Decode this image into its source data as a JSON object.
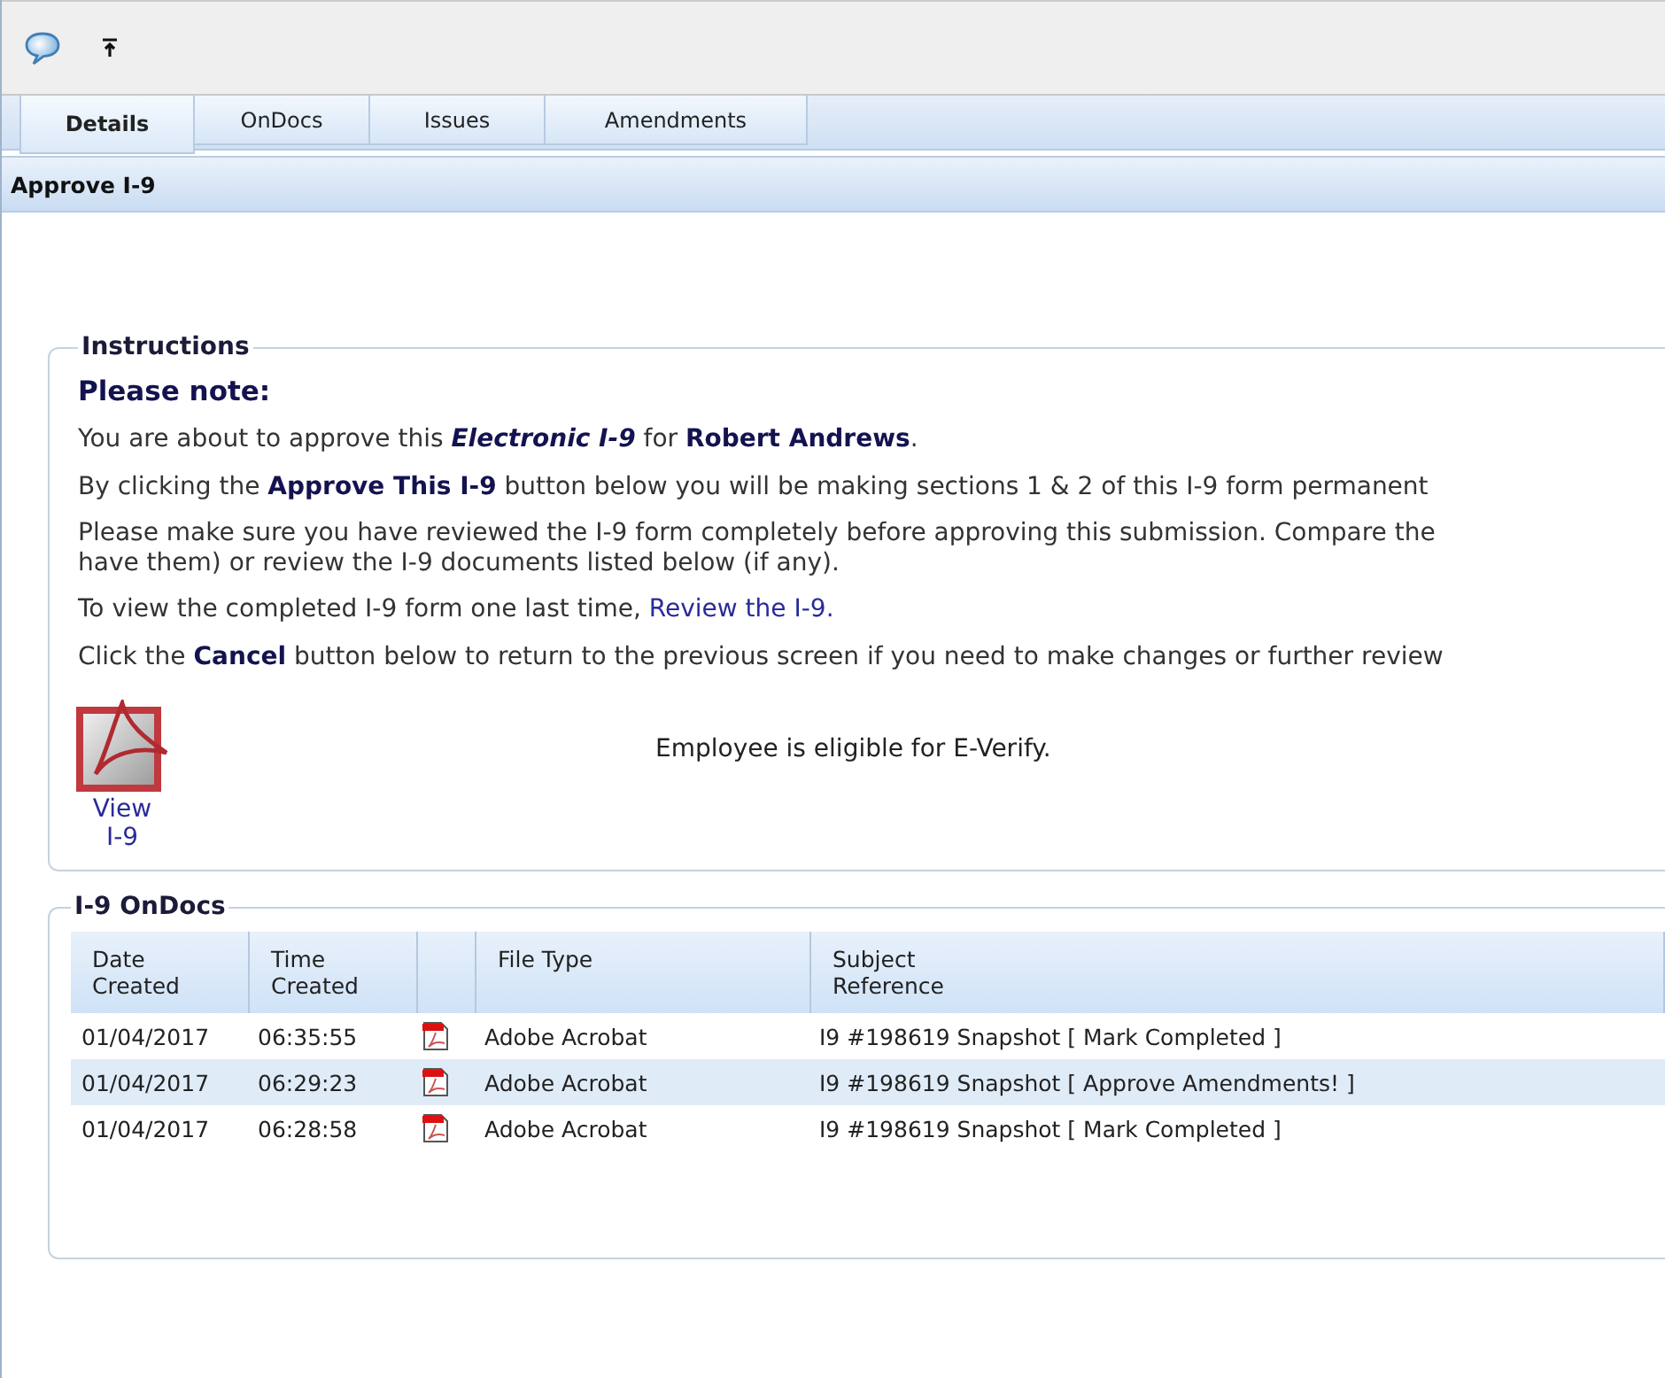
{
  "tabs": [
    {
      "label": "Details",
      "selected": true
    },
    {
      "label": "OnDocs",
      "selected": false
    },
    {
      "label": "Issues",
      "selected": false
    },
    {
      "label": "Amendments",
      "selected": false
    }
  ],
  "page_title": "Approve I-9",
  "instructions": {
    "legend": "Instructions",
    "heading": "Please note:",
    "paragraphs": [
      "You are about to approve this *Electronic I-9* for **Robert Andrews**.",
      "By clicking the **Approve This I-9** button below you will be making sections 1 & 2 of this I-9 form permanent",
      "Please make sure you have reviewed the I-9 form completely before approving this submission. Compare the\nhave them) or review the I-9 documents listed below (if any)."
    ],
    "review_text": "To view the completed I-9 form one last time, ",
    "review_link": "Review the I-9.",
    "cancel_note": "Click the **Cancel** button below to return to the previous screen if you need to make changes or further review",
    "view_link": "View I-9",
    "eligibility": "Employee is eligible for E-Verify."
  },
  "ondocs": {
    "legend": "I-9 OnDocs",
    "columns": [
      "Date Created",
      "Time Created",
      "File Type",
      "Subject Reference"
    ],
    "rows": [
      {
        "date": "01/04/2017",
        "time": "06:35:55",
        "file_type": "Adobe Acrobat",
        "subject": "I9 #198619 Snapshot [ Mark Completed ]"
      },
      {
        "date": "01/04/2017",
        "time": "06:29:23",
        "file_type": "Adobe Acrobat",
        "subject": "I9 #198619 Snapshot [ Approve Amendments! ]"
      },
      {
        "date": "01/04/2017",
        "time": "06:28:58",
        "file_type": "Adobe Acrobat",
        "subject": "I9 #198619 Snapshot [ Mark Completed ]"
      }
    ]
  }
}
